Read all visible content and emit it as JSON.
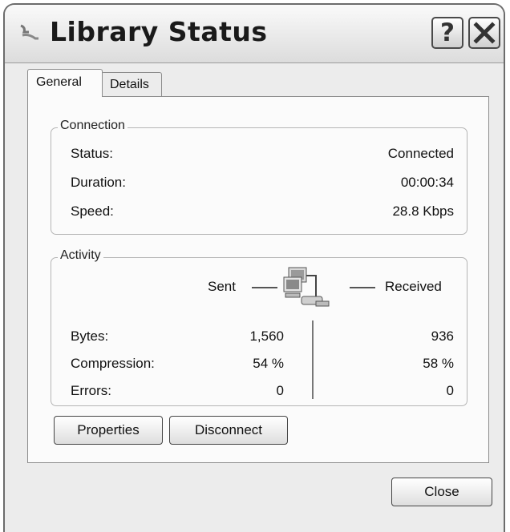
{
  "window": {
    "title": "Library Status",
    "help_label": "?"
  },
  "tabs": [
    {
      "label": "General",
      "active": true
    },
    {
      "label": "Details",
      "active": false
    }
  ],
  "connection": {
    "legend": "Connection",
    "rows": [
      {
        "label": "Status:",
        "value": "Connected"
      },
      {
        "label": "Duration:",
        "value": "00:00:34"
      },
      {
        "label": "Speed:",
        "value": "28.8 Kbps"
      }
    ]
  },
  "activity": {
    "legend": "Activity",
    "sent_header": "Sent",
    "received_header": "Received",
    "rows": [
      {
        "label": "Bytes:",
        "sent": "1,560",
        "received": "936"
      },
      {
        "label": "Compression:",
        "sent": "54 %",
        "received": "58 %"
      },
      {
        "label": "Errors:",
        "sent": "0",
        "received": "0"
      }
    ]
  },
  "buttons": {
    "properties": "Properties",
    "disconnect": "Disconnect",
    "close": "Close"
  },
  "icons": {
    "app": "network-connection-icon",
    "activity": "network-computers-icon"
  },
  "colors": {
    "dialog_bg": "#ececec",
    "panel_bg": "#fbfbfb"
  }
}
